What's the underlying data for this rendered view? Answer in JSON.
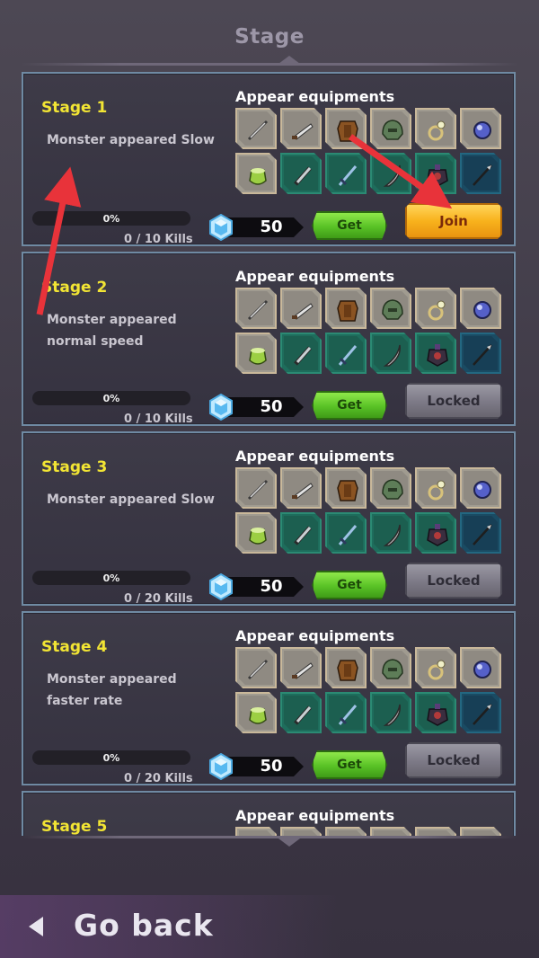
{
  "header": {
    "title": "Stage"
  },
  "stages": [
    {
      "name": "Stage 1",
      "description": "Monster appeared Slow",
      "progress_text": "0%",
      "progress": 0,
      "kills_text": "0 / 10 Kills",
      "equip_title": "Appear equipments",
      "gem_cost": "50",
      "get_label": "Get",
      "action_label": "Join",
      "action_state": "join"
    },
    {
      "name": "Stage 2",
      "description": "Monster appeared normal speed",
      "progress_text": "0%",
      "progress": 0,
      "kills_text": "0 / 10 Kills",
      "equip_title": "Appear equipments",
      "gem_cost": "50",
      "get_label": "Get",
      "action_label": "Locked",
      "action_state": "locked"
    },
    {
      "name": "Stage 3",
      "description": "Monster appeared Slow",
      "progress_text": "0%",
      "progress": 0,
      "kills_text": "0 / 20 Kills",
      "equip_title": "Appear equipments",
      "gem_cost": "50",
      "get_label": "Get",
      "action_label": "Locked",
      "action_state": "locked"
    },
    {
      "name": "Stage 4",
      "description": "Monster appeared faster rate",
      "progress_text": "0%",
      "progress": 0,
      "kills_text": "0 / 20 Kills",
      "equip_title": "Appear equipments",
      "gem_cost": "50",
      "get_label": "Get",
      "action_label": "Locked",
      "action_state": "locked"
    },
    {
      "name": "Stage 5",
      "equip_title": "Appear equipments"
    }
  ],
  "equipment_slots": [
    {
      "rarity": "gray",
      "icon": "dagger-icon"
    },
    {
      "rarity": "gray",
      "icon": "knife-icon"
    },
    {
      "rarity": "gray",
      "icon": "leather-armor-icon"
    },
    {
      "rarity": "gray",
      "icon": "green-helmet-icon"
    },
    {
      "rarity": "gray",
      "icon": "ring-icon"
    },
    {
      "rarity": "gray",
      "icon": "blue-gem-icon"
    },
    {
      "rarity": "gray",
      "icon": "potion-icon"
    },
    {
      "rarity": "green",
      "icon": "short-sword-icon"
    },
    {
      "rarity": "green",
      "icon": "sword-icon"
    },
    {
      "rarity": "green",
      "icon": "scimitar-icon"
    },
    {
      "rarity": "green",
      "icon": "dark-armor-icon"
    },
    {
      "rarity": "blue",
      "icon": "spear-icon"
    }
  ],
  "colors": {
    "stage_name": "#f2e534",
    "join_button": "#f8b21c",
    "locked_button": "#7c7986",
    "get_button": "#59c226",
    "card_border": "#6f8aa3"
  },
  "footer": {
    "back_label": "Go back"
  }
}
